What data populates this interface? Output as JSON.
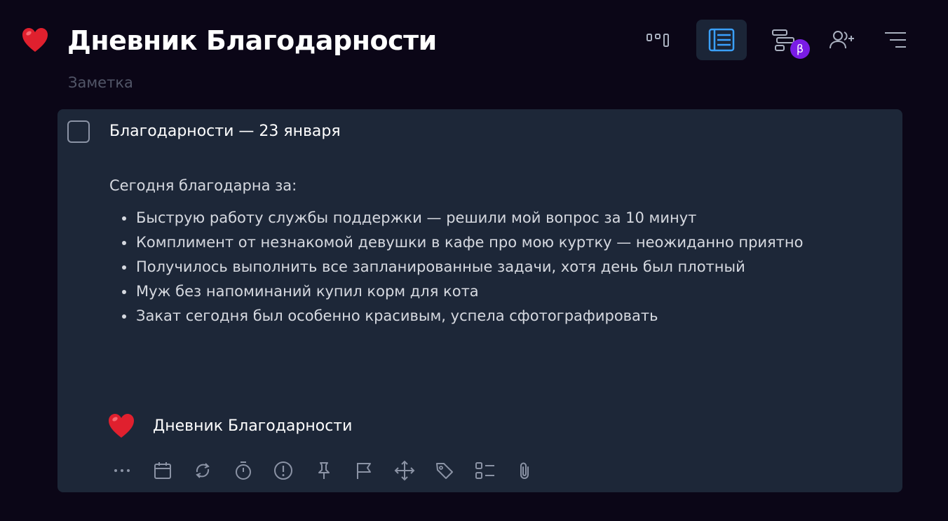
{
  "header": {
    "title": "Дневник Благодарности",
    "subtitle": "Заметка",
    "title_icon": "heart-icon",
    "toolbar": [
      {
        "icon": "board-view-icon",
        "active": false
      },
      {
        "icon": "list-view-icon",
        "active": true
      },
      {
        "icon": "timeline-view-icon",
        "active": false,
        "badge": "β"
      },
      {
        "icon": "add-user-icon",
        "active": false
      },
      {
        "icon": "menu-icon",
        "active": false
      }
    ]
  },
  "note": {
    "checked": false,
    "title": "Благодарности — 23 января",
    "intro": "Сегодня благодарна за:",
    "items": [
      "Быструю работу службы поддержки — решили мой вопрос за 10 минут",
      "Комплимент от незнакомой девушки в кафе про мою куртку — неожиданно приятно",
      "Получилось выполнить все запланированные задачи, хотя день был плотный",
      "Муж без напоминаний купил корм для кота",
      "Закат сегодня был особенно красивым, успела сфотографировать"
    ],
    "project": {
      "label": "Дневник Благодарности",
      "icon": "heart-icon"
    },
    "actions": [
      "more-icon",
      "calendar-icon",
      "repeat-icon",
      "timer-icon",
      "priority-icon",
      "pin-icon",
      "flag-icon",
      "move-icon",
      "tag-icon",
      "subtasks-icon",
      "attachment-icon"
    ]
  },
  "colors": {
    "background": "#0b0617",
    "card": "#1d2738",
    "active_button": "#1b2537",
    "accent": "#3aa0ff",
    "beta_badge": "#7a1ce6",
    "heart": "#e0202e"
  }
}
